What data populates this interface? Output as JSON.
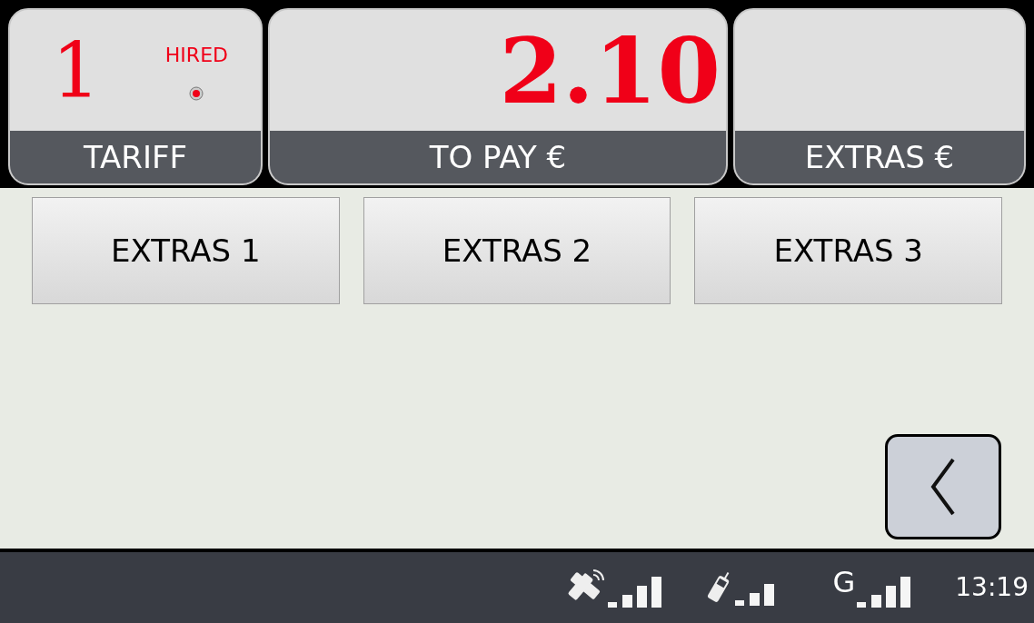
{
  "meter": {
    "tariff": {
      "value": "1",
      "status": "HIRED",
      "label": "TARIFF"
    },
    "to_pay": {
      "value": "2.10",
      "label": "TO PAY €"
    },
    "extras": {
      "label": "EXTRAS €"
    }
  },
  "extras_buttons": [
    "EXTRAS 1",
    "EXTRAS 2",
    "EXTRAS 3"
  ],
  "status_bar": {
    "network": "G",
    "time": "13:19"
  }
}
